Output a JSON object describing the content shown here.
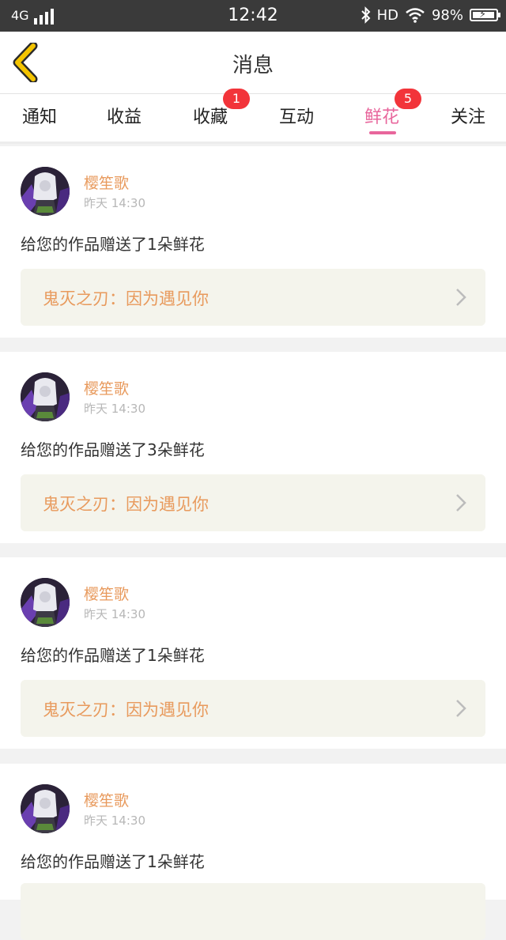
{
  "status_bar": {
    "network": "4G",
    "time": "12:42",
    "hd": "HD",
    "battery_text": "98%",
    "battery_level": 0.98,
    "icons": [
      "signal-bars-icon",
      "bluetooth-icon",
      "wifi-icon",
      "battery-charging-icon"
    ]
  },
  "header": {
    "title": "消息",
    "back_icon": "chevron-left-icon",
    "accent_color": "#f4c400"
  },
  "tabs": [
    {
      "label": "通知",
      "badge": null
    },
    {
      "label": "收益",
      "badge": null
    },
    {
      "label": "收藏",
      "badge": "1"
    },
    {
      "label": "互动",
      "badge": null
    },
    {
      "label": "鲜花",
      "badge": "5",
      "active": true
    },
    {
      "label": "关注",
      "badge": null
    }
  ],
  "colors": {
    "active_tab": "#e8669c",
    "badge": "#f2343a",
    "sender": "#e89a5d",
    "link_bg": "#f4f4ec"
  },
  "messages": [
    {
      "sender": "樱笙歌",
      "time": "昨天 14:30",
      "text": "给您的作品赠送了1朵鲜花",
      "work": "鬼灭之刃：因为遇见你"
    },
    {
      "sender": "樱笙歌",
      "time": "昨天 14:30",
      "text": "给您的作品赠送了3朵鲜花",
      "work": "鬼灭之刃：因为遇见你"
    },
    {
      "sender": "樱笙歌",
      "time": "昨天 14:30",
      "text": "给您的作品赠送了1朵鲜花",
      "work": "鬼灭之刃：因为遇见你"
    },
    {
      "sender": "樱笙歌",
      "time": "昨天 14:30",
      "text": "给您的作品赠送了1朵鲜花",
      "work": ""
    }
  ]
}
